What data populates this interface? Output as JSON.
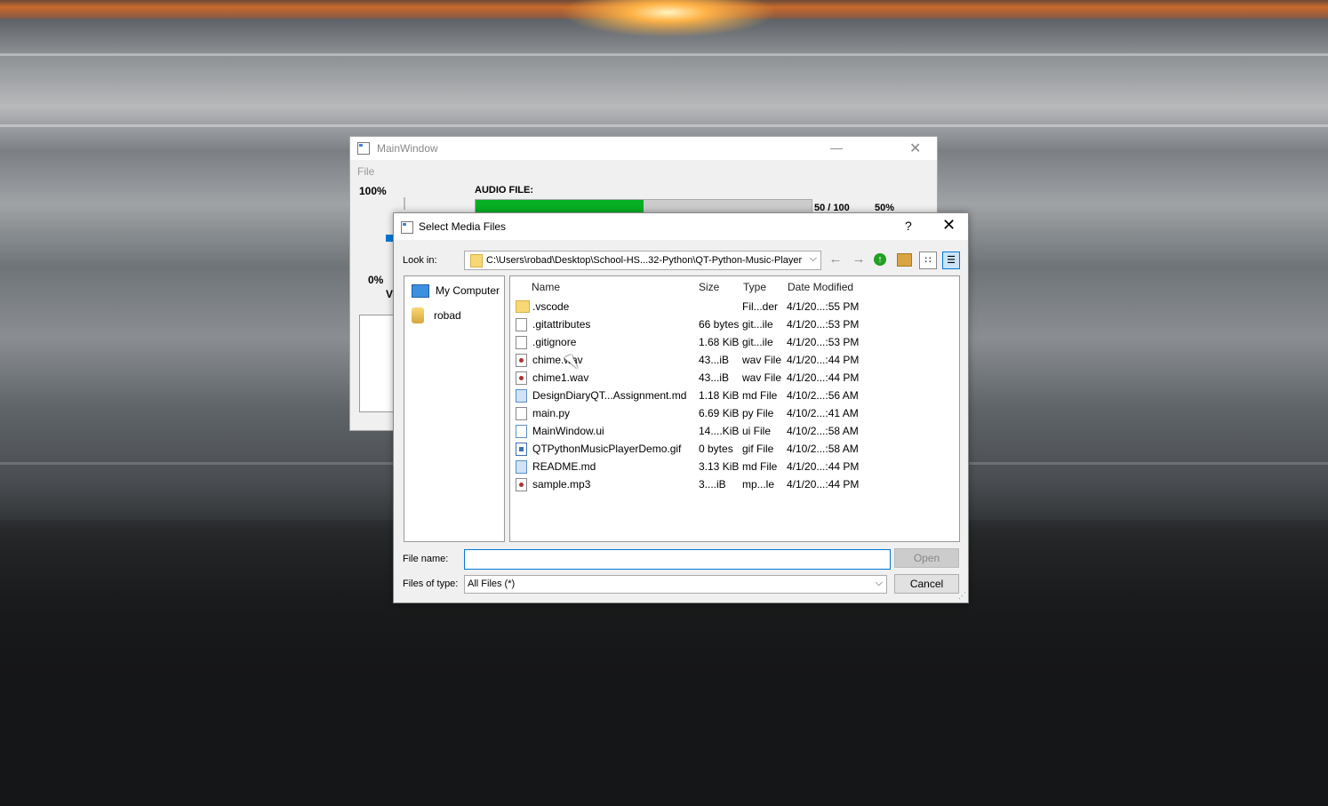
{
  "main_window": {
    "title": "MainWindow",
    "minimize": "—",
    "close": "✕",
    "menu_file": "File",
    "volume_max": "100%",
    "volume_min": "0%",
    "volume_label_fragment": "V",
    "audio_file_label": "AUDIO FILE:",
    "progress_count": "50 / 100",
    "progress_percent": "50%",
    "progress_fraction": 0.5
  },
  "dialog": {
    "title": "Select Media Files",
    "help": "?",
    "close": "✕",
    "look_in_label": "Look in:",
    "look_in_path": "C:\\Users\\robad\\Desktop\\School-HS...32-Python\\QT-Python-Music-Player",
    "sidebar": [
      {
        "label": "My Computer",
        "icon": "computer-icon"
      },
      {
        "label": "robad",
        "icon": "user-folder-icon"
      }
    ],
    "columns": {
      "name": "Name",
      "size": "Size",
      "type": "Type",
      "modified": "Date Modified"
    },
    "files": [
      {
        "name": ".vscode",
        "size": "",
        "type": "Fil...der",
        "modified": "4/1/20...:55 PM",
        "icon": "folder"
      },
      {
        "name": ".gitattributes",
        "size": "66 bytes",
        "type": "git...ile",
        "modified": "4/1/20...:53 PM",
        "icon": "text"
      },
      {
        "name": ".gitignore",
        "size": "1.68 KiB",
        "type": "git...ile",
        "modified": "4/1/20...:53 PM",
        "icon": "text"
      },
      {
        "name": "chime.wav",
        "size": "43...iB",
        "type": "wav File",
        "modified": "4/1/20...:44 PM",
        "icon": "audio"
      },
      {
        "name": "chime1.wav",
        "size": "43...iB",
        "type": "wav File",
        "modified": "4/1/20...:44 PM",
        "icon": "audio"
      },
      {
        "name": "DesignDiaryQT...Assignment.md",
        "size": "1.18 KiB",
        "type": "md File",
        "modified": "4/10/2...:56 AM",
        "icon": "md"
      },
      {
        "name": "main.py",
        "size": "6.69 KiB",
        "type": "py File",
        "modified": "4/10/2...:41 AM",
        "icon": "text"
      },
      {
        "name": "MainWindow.ui",
        "size": "14....KiB",
        "type": "ui File",
        "modified": "4/10/2...:58 AM",
        "icon": "ui"
      },
      {
        "name": "QTPythonMusicPlayerDemo.gif",
        "size": "0 bytes",
        "type": "gif File",
        "modified": "4/10/2...:58 AM",
        "icon": "gif"
      },
      {
        "name": "README.md",
        "size": "3.13 KiB",
        "type": "md File",
        "modified": "4/1/20...:44 PM",
        "icon": "md"
      },
      {
        "name": "sample.mp3",
        "size": "3....iB",
        "type": "mp...le",
        "modified": "4/1/20...:44 PM",
        "icon": "audio"
      }
    ],
    "file_name_label": "File name:",
    "file_name_value": "",
    "files_of_type_label": "Files of type:",
    "files_of_type_value": "All Files (*)",
    "open_button": "Open",
    "cancel_button": "Cancel"
  },
  "colors": {
    "progress_fill": "#06b025",
    "focus_border": "#0078d7"
  }
}
